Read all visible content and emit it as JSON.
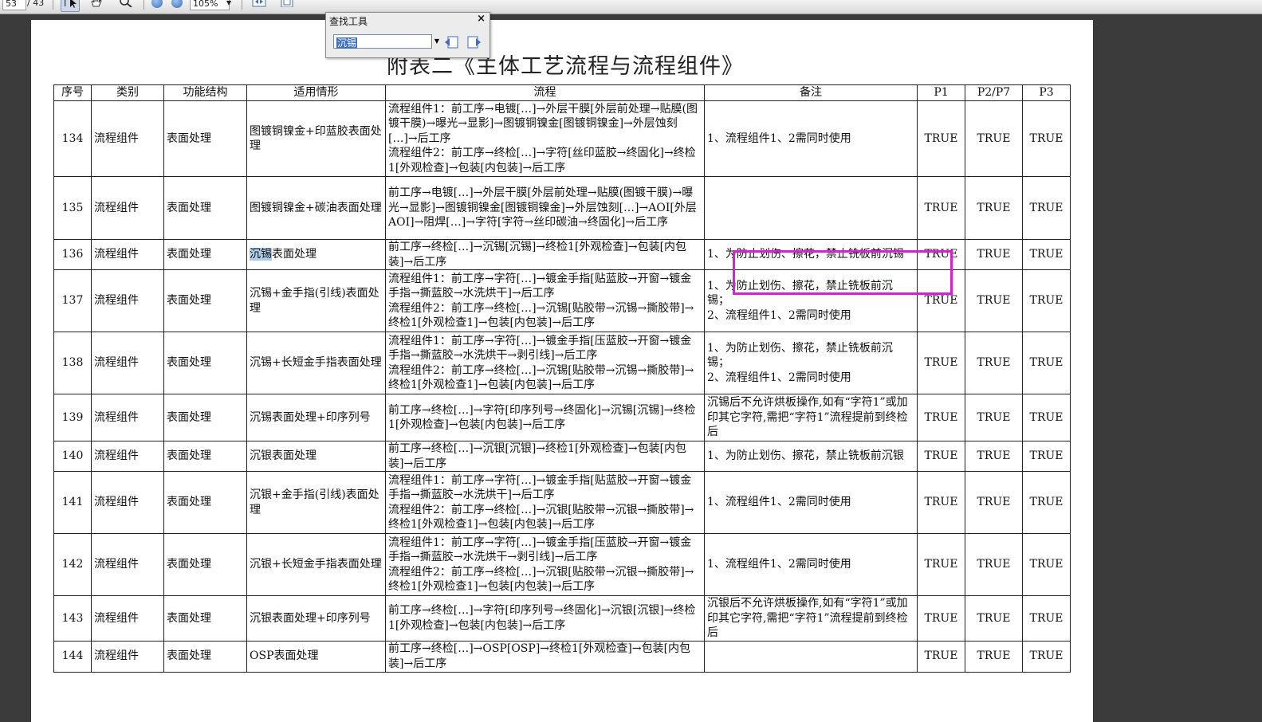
{
  "toolbar": {
    "page_current": "53",
    "page_total": "/ 43",
    "zoom": "105%",
    "icons": [
      "select-tool-icon",
      "hand-tool-icon",
      "zoom-tool-icon",
      "zoom-out-icon",
      "zoom-in-icon",
      "fit-width-icon",
      "fit-page-icon"
    ]
  },
  "find": {
    "title": "查找工具",
    "close": "×",
    "value": "沉锡"
  },
  "doc": {
    "title": "附表二《主体工艺流程与流程组件》",
    "headers": [
      "序号",
      "类别",
      "功能结构",
      "适用情形",
      "流程",
      "备注",
      "P1",
      "P2/P7",
      "P3"
    ],
    "rows": [
      {
        "no": "134",
        "cat": "流程组件",
        "func": "表面处理",
        "case": "图镀铜镍金+印蓝胶表面处理",
        "flow": "流程组件1：前工序→电镀[…]→外层干膜[外层前处理→贴膜(图镀干膜)→曝光→显影]→图镀铜镍金[图镀铜镍金]→外层蚀刻[…]→后工序\n流程组件2：前工序→终检[…]→字符[丝印蓝胶→终固化]→终检1[外观检查]→包装[内包装]→后工序",
        "note": "1、流程组件1、2需同时使用",
        "p1": "TRUE",
        "p2": "TRUE",
        "p3": "TRUE"
      },
      {
        "no": "135",
        "cat": "流程组件",
        "func": "表面处理",
        "case": "图镀铜镍金+碳油表面处理",
        "flow": "前工序→电镀[…]→外层干膜[外层前处理→贴膜(图镀干膜)→曝光→显影]→图镀铜镍金[图镀铜镍金]→外层蚀刻[…]→AOI[外层AOI]→阻焊[…]→字符[字符→丝印碳油→终固化]→后工序",
        "note": "",
        "p1": "TRUE",
        "p2": "TRUE",
        "p3": "TRUE"
      },
      {
        "no": "136",
        "cat": "流程组件",
        "func": "表面处理",
        "case_hl": "沉锡",
        "case_rest": "表面处理",
        "flow": "前工序→终检[…]→沉锡[沉锡]→终检1[外观检查]→包装[内包装]→后工序",
        "note": "1、为防止划伤、擦花，禁止铣板前沉锡",
        "p1": "TRUE",
        "p2": "TRUE",
        "p3": "TRUE"
      },
      {
        "no": "137",
        "cat": "流程组件",
        "func": "表面处理",
        "case": "沉锡+金手指(引线)表面处理",
        "flow": "流程组件1：前工序→字符[…]→镀金手指[贴蓝胶→开窗→镀金手指→撕蓝胶→水洗烘干]→后工序\n流程组件2：前工序→终检[…]→沉锡[贴胶带→沉锡→撕胶带]→终检1[外观检查1]→包装[内包装]→后工序",
        "note": "1、为防止划伤、擦花，禁止铣板前沉锡；\n2、流程组件1、2需同时使用",
        "p1": "TRUE",
        "p2": "TRUE",
        "p3": "TRUE"
      },
      {
        "no": "138",
        "cat": "流程组件",
        "func": "表面处理",
        "case": "沉锡+长短金手指表面处理",
        "flow": "流程组件1：前工序→字符[…]→镀金手指[压蓝胶→开窗→镀金手指→撕蓝胶→水洗烘干→剥引线]→后工序\n流程组件2：前工序→终检[…]→沉锡[贴胶带→沉锡→撕胶带]→终检1[外观检查1]→包装[内包装]→后工序",
        "note": "1、为防止划伤、擦花，禁止铣板前沉锡；\n2、流程组件1、2需同时使用",
        "p1": "TRUE",
        "p2": "TRUE",
        "p3": "TRUE"
      },
      {
        "no": "139",
        "cat": "流程组件",
        "func": "表面处理",
        "case": "沉锡表面处理+印序列号",
        "flow": "前工序→终检[…]→字符[印序列号→终固化]→沉锡[沉锡]→终检1[外观检查]→包装[内包装]→后工序",
        "note": "沉锡后不允许烘板操作,如有“字符1”或加印其它字符,需把“字符1”流程提前到终检后",
        "p1": "TRUE",
        "p2": "TRUE",
        "p3": "TRUE"
      },
      {
        "no": "140",
        "cat": "流程组件",
        "func": "表面处理",
        "case": "沉银表面处理",
        "flow": "前工序→终检[…]→沉银[沉银]→终检1[外观检查]→包装[内包装]→后工序",
        "note": "1、为防止划伤、擦花，禁止铣板前沉银",
        "p1": "TRUE",
        "p2": "TRUE",
        "p3": "TRUE"
      },
      {
        "no": "141",
        "cat": "流程组件",
        "func": "表面处理",
        "case": "沉银+金手指(引线)表面处理",
        "flow": "流程组件1：前工序→字符[…]→镀金手指[贴蓝胶→开窗→镀金手指→撕蓝胶→水洗烘干]→后工序\n流程组件2：前工序→终检[…]→沉银[贴胶带→沉银→撕胶带]→终检1[外观检查1]→包装[内包装]→后工序",
        "note": "1、流程组件1、2需同时使用",
        "p1": "TRUE",
        "p2": "TRUE",
        "p3": "TRUE"
      },
      {
        "no": "142",
        "cat": "流程组件",
        "func": "表面处理",
        "case": "沉银+长短金手指表面处理",
        "flow": "流程组件1：前工序→字符[…]→镀金手指[压蓝胶→开窗→镀金手指→撕蓝胶→水洗烘干→剥引线]→后工序\n流程组件2：前工序→终检[…]→沉银[贴胶带→沉银→撕胶带]→终检1[外观检查1]→包装[内包装]→后工序",
        "note": "1、流程组件1、2需同时使用",
        "p1": "TRUE",
        "p2": "TRUE",
        "p3": "TRUE"
      },
      {
        "no": "143",
        "cat": "流程组件",
        "func": "表面处理",
        "case": "沉银表面处理+印序列号",
        "flow": "前工序→终检[…]→字符[印序列号→终固化]→沉银[沉银]→终检1[外观检查]→包装[内包装]→后工序",
        "note": "沉银后不允许烘板操作,如有“字符1”或加印其它字符,需把“字符1”流程提前到终检后",
        "p1": "TRUE",
        "p2": "TRUE",
        "p3": "TRUE"
      },
      {
        "no": "144",
        "cat": "流程组件",
        "func": "表面处理",
        "case": "OSP表面处理",
        "flow": "前工序→终检[…]→OSP[OSP]→终检1[外观检查]→包装[内包装]→后工序",
        "note": "",
        "p1": "TRUE",
        "p2": "TRUE",
        "p3": "TRUE"
      }
    ]
  },
  "colors": {
    "annotation": "#d91ed7",
    "search_highlight": "#aecde8",
    "viewer_bg": "#3b3b3b"
  }
}
